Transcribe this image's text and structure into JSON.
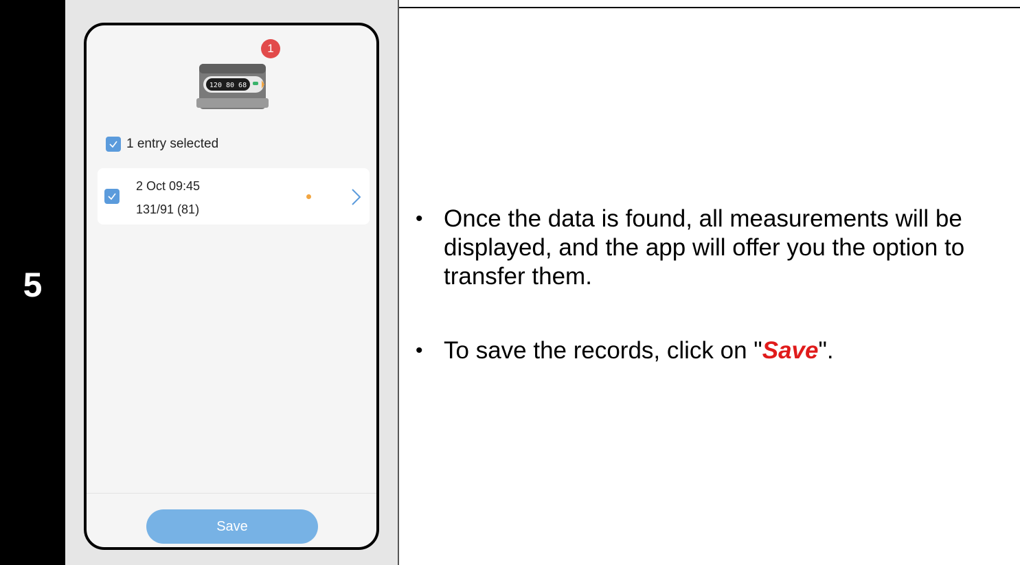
{
  "step": {
    "number": "5"
  },
  "app": {
    "badge_count": "1",
    "device_display": "120 80 68",
    "selection_label": "1 entry selected",
    "entries": [
      {
        "date": "2 Oct 09:45",
        "reading": "131/91 (81)"
      }
    ],
    "save_label": "Save"
  },
  "instructions": {
    "bullet1": "Once the data is found, all measurements will be displayed, and the app will offer you the option to transfer them.",
    "bullet2_prefix": "To save the records, click on \"",
    "bullet2_highlight": "Save",
    "bullet2_suffix": "\"."
  },
  "colors": {
    "accent": "#5b9bdc",
    "button": "#77b2e5",
    "badge": "#e24a4a",
    "status_dot": "#f2a541",
    "highlight": "#e01b1b"
  }
}
